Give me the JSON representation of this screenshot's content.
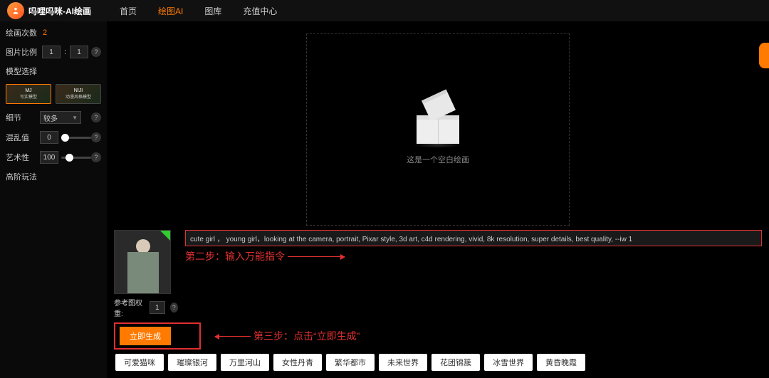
{
  "brand": "吗哩吗咪-AI绘画",
  "nav": {
    "home": "首页",
    "drawAI": "绘图AI",
    "gallery": "图库",
    "recharge": "充值中心"
  },
  "sidebar": {
    "drawCountLabel": "绘画次数",
    "drawCount": "2",
    "ratioLabel": "图片比例",
    "ratioW": "1",
    "ratioH": "1",
    "modelLabel": "模型选择",
    "model1": {
      "title": "MJ",
      "sub": "写实模型"
    },
    "model2": {
      "title": "NIJI",
      "sub": "动漫风格模型"
    },
    "detailLabel": "细节",
    "detailValue": "较多",
    "chaosLabel": "混乱值",
    "chaosValue": "0",
    "artLabel": "艺术性",
    "artValue": "100",
    "advanced": "高阶玩法"
  },
  "canvas": {
    "emptyText": "这是一个空白绘画"
  },
  "ref": {
    "weightLabel": "参考图权重:",
    "weightValue": "1"
  },
  "prompt": "cute girl ， young girl，looking at the camera, portrait, Pixar style, 3d art, c4d rendering, vivid, 8k resolution, super details, best quality, --iw 1",
  "annotation2": "第二步：输入万能指令",
  "generate": "立即生成",
  "annotation3": "第三步：点击“立即生成”",
  "tags": [
    "可爱猫咪",
    "璀璨银河",
    "万里河山",
    "女性丹青",
    "繁华都市",
    "未来世界",
    "花团锦簇",
    "冰雪世界",
    "黄昏晚霞"
  ]
}
